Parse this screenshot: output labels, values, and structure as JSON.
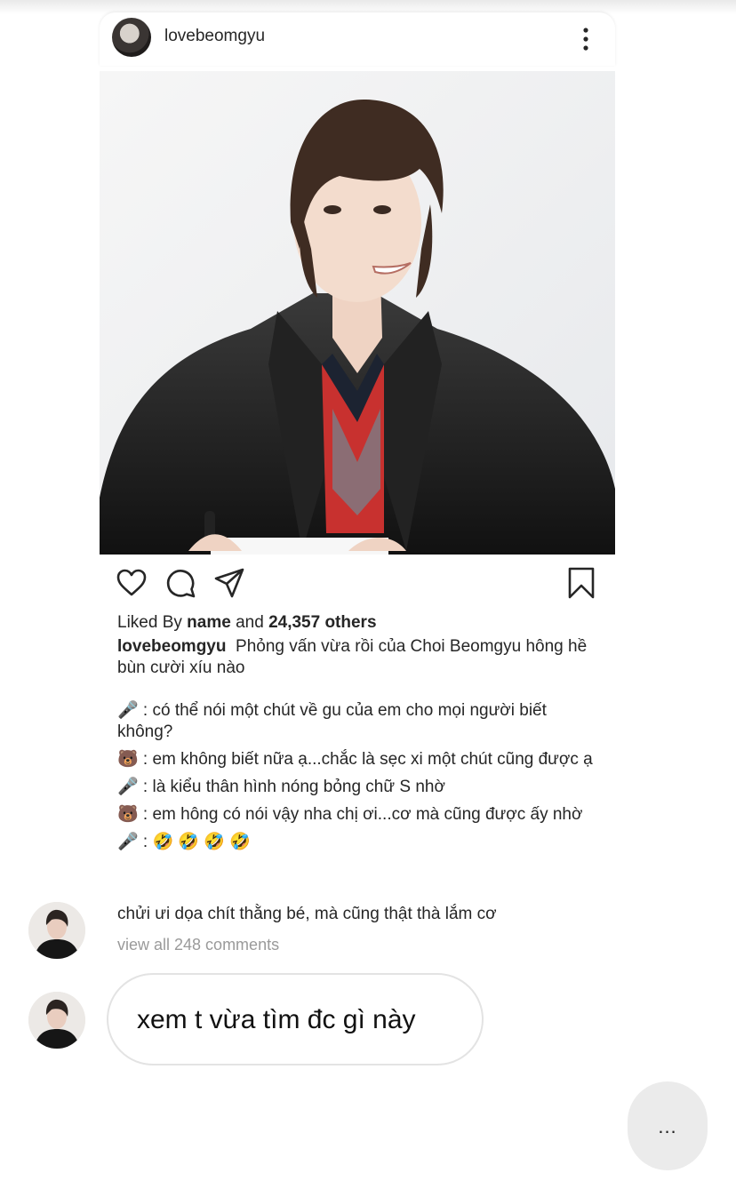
{
  "post": {
    "username": "lovebeomgyu",
    "more_icon": "more-vertical-icon",
    "likes_prefix": "Liked By ",
    "likes_name": "name",
    "likes_and": " and ",
    "likes_count": "24,357 others",
    "caption_username": "lovebeomgyu",
    "caption_text": "Phỏng vấn vừa rồi của Choi Beomgyu hông hề bùn cười xíu nào",
    "dialog": [
      "🎤 : có thể nói một chút về gu của em cho mọi người biết không?",
      "🐻 : em không biết nữa ạ...chắc là sẹc xi một chút cũng được ạ",
      "🎤 : là kiểu thân hình nóng bỏng chữ S nhờ",
      "🐻 : em hông có nói vậy nha chị ơi...cơ mà cũng được ấy nhờ",
      "🎤 : 🤣 🤣 🤣 🤣"
    ],
    "comment": "chửi ưi dọa chít thằng bé, mà cũng thật thà lắm cơ",
    "view_all": "view all 248 comments"
  },
  "chat": {
    "message": "xem t vừa tìm đc gì này",
    "typing": "..."
  },
  "icons": [
    "heart-icon",
    "comment-icon",
    "share-icon",
    "bookmark-icon"
  ]
}
